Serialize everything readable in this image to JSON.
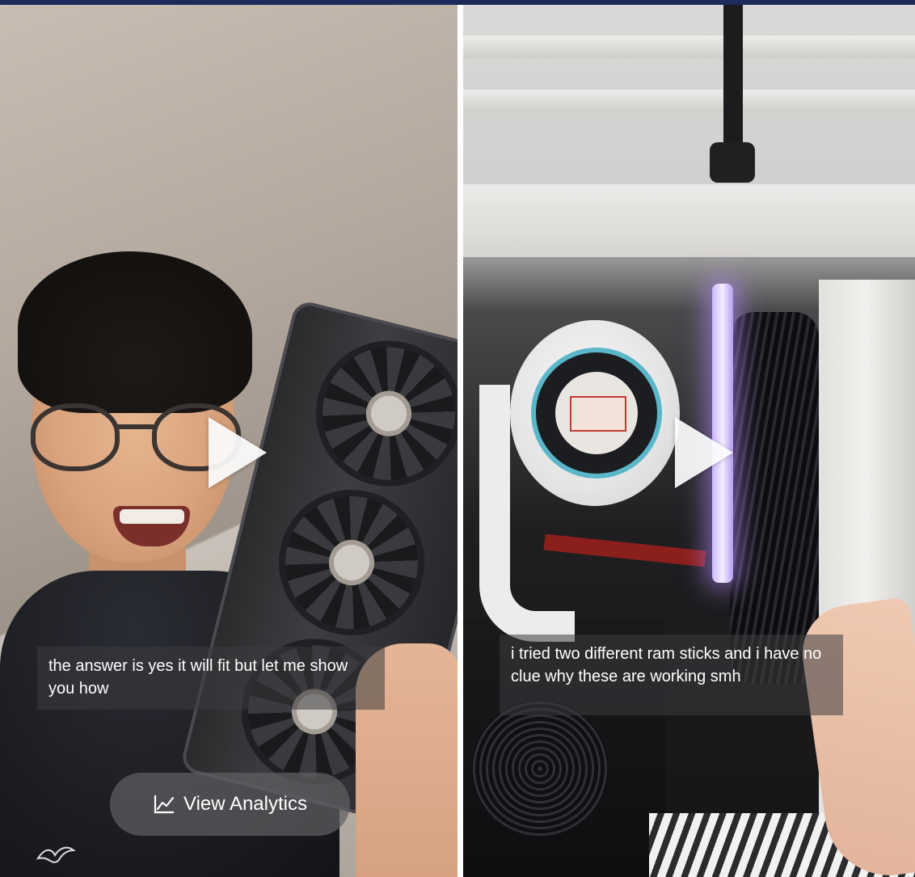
{
  "left_video": {
    "caption": "the answer is yes it will fit but let me show you how",
    "analytics_button": {
      "label": "View Analytics",
      "icon": "analytics-chart-icon"
    },
    "logo_icon": "seagull-logo-icon",
    "play_icon": "play-icon"
  },
  "right_video": {
    "caption": "i tried two different ram sticks and i have no clue why these are working smh",
    "play_icon": "play-icon"
  },
  "colors": {
    "top_bar": "#1d2b5c",
    "caption_bg": "rgba(60,60,64,0.55)",
    "pill_bg": "rgba(95,95,98,0.72)",
    "text": "#ffffff"
  }
}
